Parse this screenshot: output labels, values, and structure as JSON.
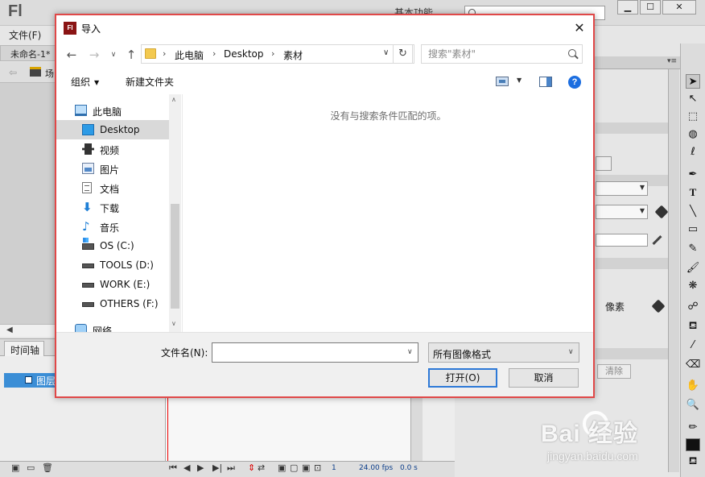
{
  "flash": {
    "logo": "Fl",
    "workspace_label": "基本功能",
    "menu_file": "文件(F)",
    "doc_tab": "未命名-1*",
    "scene_label": "场",
    "timeline_tab": "时间轴",
    "layer_label": "图层",
    "pixels_label": "像素",
    "clear_label": "清除",
    "status_frame": "1",
    "status_fps": "24.00 fps",
    "status_time": "0.0 s"
  },
  "dialog": {
    "title": "导入",
    "breadcrumb": [
      "此电脑",
      "Desktop",
      "素材"
    ],
    "search_placeholder": "搜索\"素材\"",
    "organize_label": "组织",
    "new_folder_label": "新建文件夹",
    "empty_message": "没有与搜索条件匹配的项。",
    "nav_items": [
      {
        "label": "此电脑",
        "icon": "computer-icon"
      },
      {
        "label": "Desktop",
        "icon": "desktop-icon"
      },
      {
        "label": "视频",
        "icon": "video-icon"
      },
      {
        "label": "图片",
        "icon": "pictures-icon"
      },
      {
        "label": "文档",
        "icon": "documents-icon"
      },
      {
        "label": "下载",
        "icon": "download-icon"
      },
      {
        "label": "音乐",
        "icon": "music-icon"
      },
      {
        "label": "OS (C:)",
        "icon": "os-drive-icon"
      },
      {
        "label": "TOOLS (D:)",
        "icon": "drive-icon"
      },
      {
        "label": "WORK (E:)",
        "icon": "drive-icon"
      },
      {
        "label": "OTHERS (F:)",
        "icon": "drive-icon"
      },
      {
        "label": "网络",
        "icon": "network-icon"
      }
    ],
    "selected_nav": "Desktop",
    "filename_label": "文件名(N):",
    "filename_value": "",
    "filetype_value": "所有图像格式",
    "open_label": "打开(O)",
    "cancel_label": "取消"
  },
  "watermark": {
    "brand": "Bai  经验",
    "domain": "jingyan.baidu.com"
  },
  "colors": {
    "dialog_border": "#e04848",
    "open_focus": "#2d79d7",
    "selected_nav_bg": "#d9d9d9",
    "layer_row": "#3b8ed6"
  }
}
